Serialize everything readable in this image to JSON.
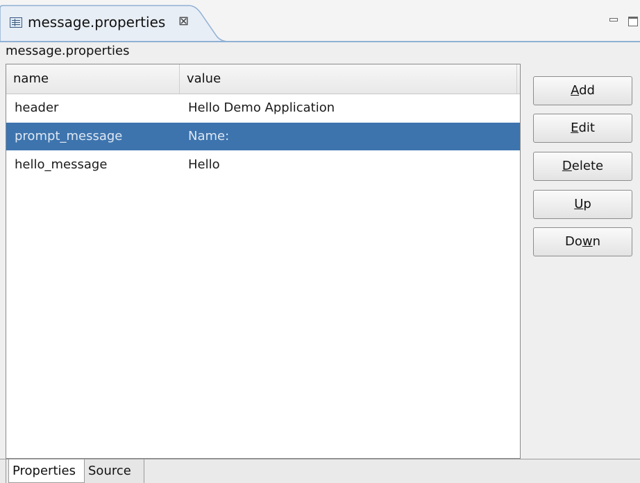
{
  "editor_tab": {
    "title": "message.properties",
    "close_glyph": "⊠",
    "icon": "properties-file-icon"
  },
  "window_controls": {
    "minimize_icon": "minimize-icon",
    "maximize_icon": "maximize-icon"
  },
  "file_label": "message.properties",
  "table": {
    "columns": [
      "name",
      "value"
    ],
    "rows": [
      {
        "name": "header",
        "value": "Hello Demo Application"
      },
      {
        "name": "prompt_message",
        "value": "Name:"
      },
      {
        "name": "hello_message",
        "value": "Hello"
      }
    ],
    "selected_index": 1
  },
  "buttons": {
    "add": {
      "label": "Add",
      "mnemonic": "A",
      "rest": "dd"
    },
    "edit": {
      "label": "Edit",
      "mnemonic": "E",
      "rest": "dit"
    },
    "delete": {
      "label": "Delete",
      "mnemonic": "D",
      "rest": "elete"
    },
    "up": {
      "label": "Up",
      "mnemonic": "U",
      "rest": "p"
    },
    "down": {
      "label": "Down",
      "pre": "Do",
      "mnemonic": "w",
      "rest": "n"
    }
  },
  "bottom_tabs": [
    "Properties",
    "Source"
  ],
  "colors": {
    "selection": "#3d74ae",
    "tab_accent": "#8fb0d4"
  }
}
